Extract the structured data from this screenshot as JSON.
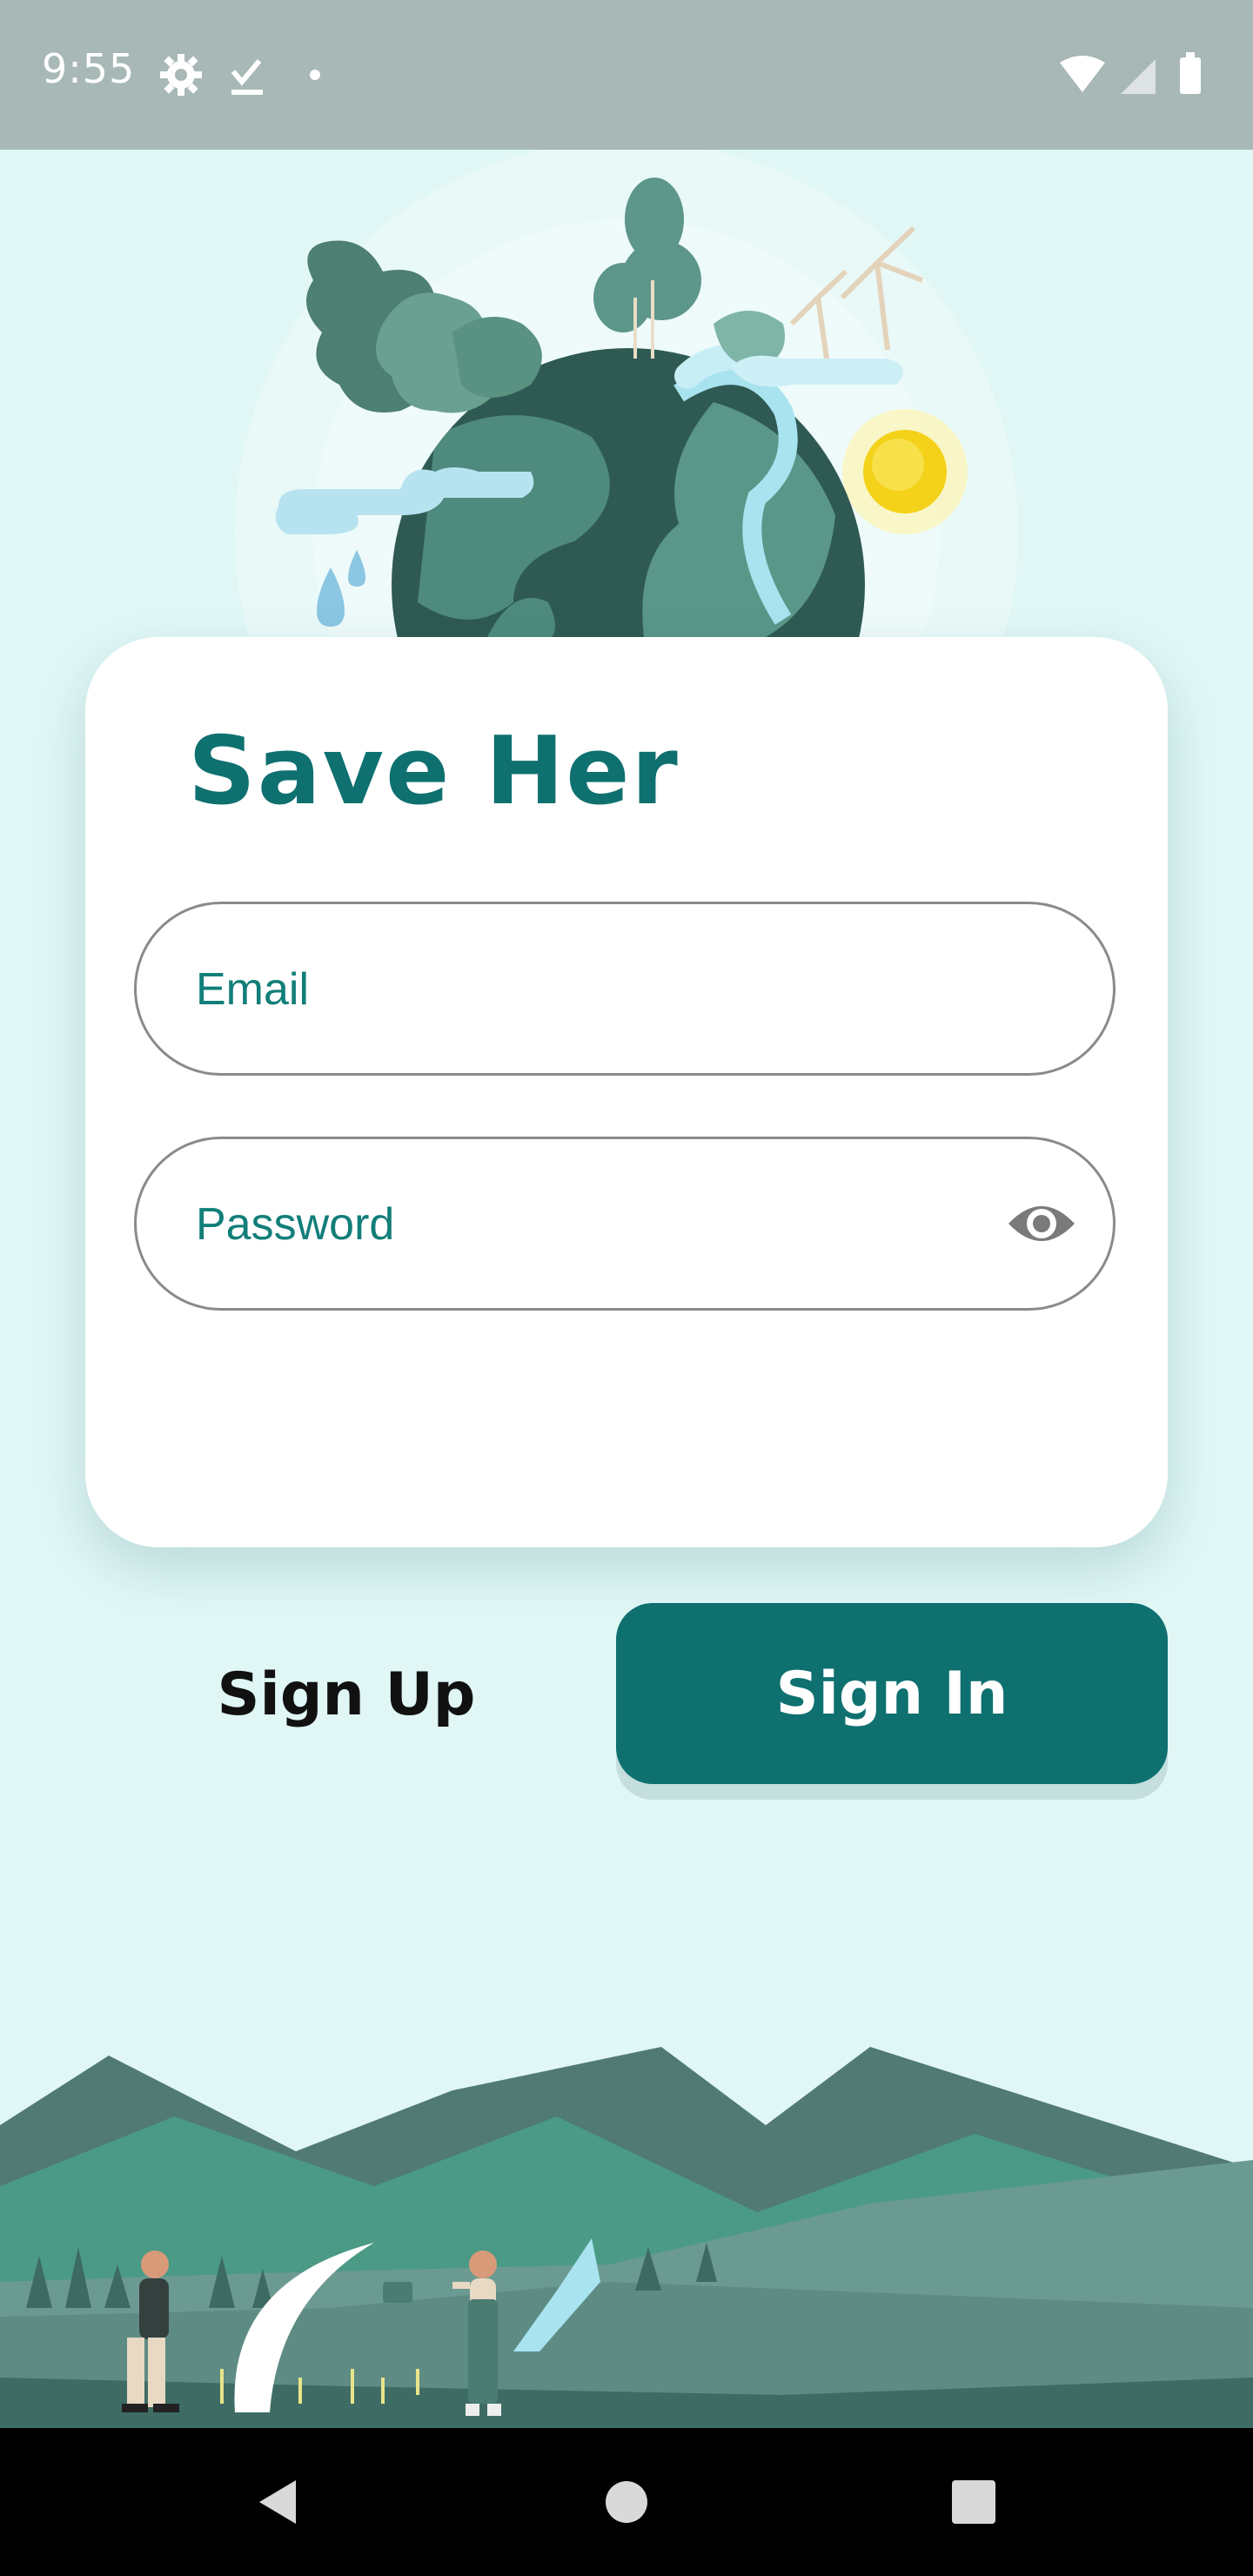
{
  "status_bar": {
    "time": "9:55",
    "left_icons": [
      "settings-icon",
      "task-done-icon",
      "notification-dot-icon"
    ],
    "right_icons": [
      "wifi-icon",
      "cell-signal-icon",
      "battery-icon"
    ]
  },
  "login": {
    "title": "Save Her",
    "email_placeholder": "Email",
    "password_placeholder": "Password",
    "password_toggle_icon": "eye-icon"
  },
  "actions": {
    "sign_up_label": "Sign Up",
    "sign_in_label": "Sign In"
  },
  "navigation": {
    "buttons": [
      "back-icon",
      "home-icon",
      "recents-icon"
    ]
  },
  "colors": {
    "accent": "#0f7070",
    "background": "#e0f7f6",
    "status_bar": "#a7b8b6",
    "card": "#ffffff",
    "field_text": "#117e79"
  }
}
